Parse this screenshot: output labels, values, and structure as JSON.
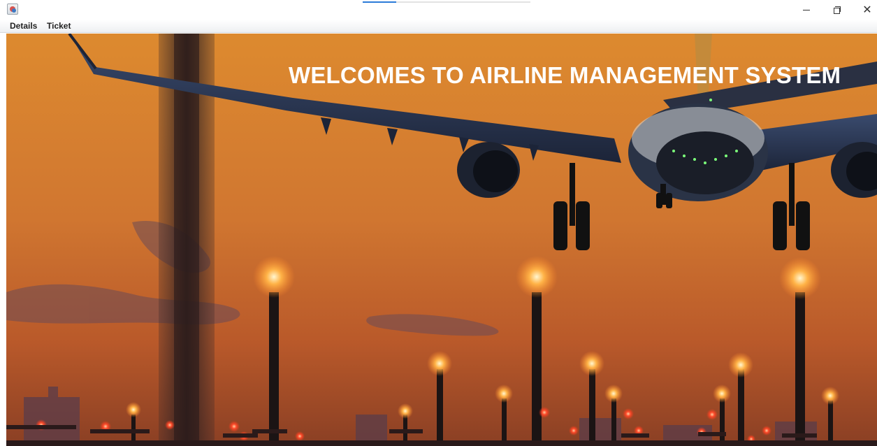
{
  "window": {
    "app_icon": "java-app-icon",
    "controls": {
      "minimize_icon": "minimize-icon",
      "restore_icon": "restore-icon",
      "close_icon": "close-icon",
      "close_glyph": "✕"
    },
    "loading_progress": 0.2
  },
  "menubar": {
    "items": [
      {
        "label": "Details"
      },
      {
        "label": "Ticket"
      }
    ]
  },
  "main": {
    "heading": "WELCOMES TO AIRLINE MANAGEMENT SYSTEM",
    "background": "airplane-landing-at-sunset-photo"
  },
  "colors": {
    "sky_top": "#d9842c",
    "sky_horizon": "#a04a22",
    "heading": "#ffffff",
    "runway_light": "#ffb347"
  }
}
